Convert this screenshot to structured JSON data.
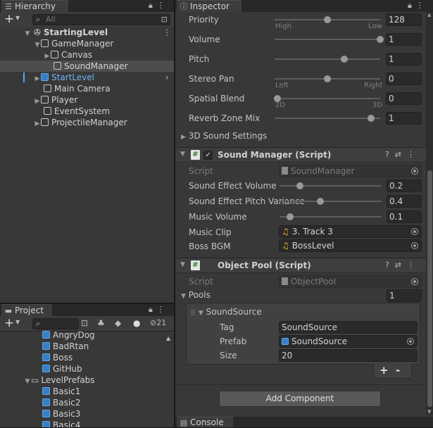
{
  "hierarchy": {
    "tab_label": "Hierarchy",
    "add_label": "+",
    "search_placeholder": "All",
    "scene_name": "StartingLevel",
    "items": [
      {
        "label": "GameManager"
      },
      {
        "label": "Canvas"
      },
      {
        "label": "SoundManager"
      },
      {
        "label": "StartLevel"
      },
      {
        "label": "Main Camera"
      },
      {
        "label": "Player"
      },
      {
        "label": "EventSystem"
      },
      {
        "label": "ProjectileManager"
      }
    ]
  },
  "project": {
    "tab_label": "Project",
    "add_label": "+",
    "hidden_count": "21",
    "items": [
      {
        "label": "AngryDog"
      },
      {
        "label": "BadRtan"
      },
      {
        "label": "Boss"
      },
      {
        "label": "GitHub"
      },
      {
        "label": "LevelPrefabs"
      },
      {
        "label": "Basic1"
      },
      {
        "label": "Basic2"
      },
      {
        "label": "Basic3"
      },
      {
        "label": "Basic4"
      }
    ]
  },
  "inspector": {
    "tab_label": "Inspector",
    "audio_source": {
      "priority": {
        "label": "Priority",
        "value": "128",
        "min_label": "High",
        "max_label": "Low",
        "fraction": 0.5
      },
      "volume": {
        "label": "Volume",
        "value": "1",
        "fraction": 1.0
      },
      "pitch": {
        "label": "Pitch",
        "value": "1",
        "fraction": 0.66
      },
      "stereo_pan": {
        "label": "Stereo Pan",
        "value": "0",
        "min_label": "Left",
        "max_label": "Right",
        "fraction": 0.5
      },
      "spatial_blend": {
        "label": "Spatial Blend",
        "value": "0",
        "min_label": "2D",
        "max_label": "3D",
        "fraction": 0.0
      },
      "reverb": {
        "label": "Reverb Zone Mix",
        "value": "1",
        "fraction": 0.91
      },
      "sound_settings_label": "3D Sound Settings"
    },
    "sound_manager": {
      "title": "Sound Manager (Script)",
      "script_label": "Script",
      "script_value": "SoundManager",
      "sfx_volume": {
        "label": "Sound Effect Volume",
        "value": "0.2",
        "fraction": 0.2
      },
      "sfx_pitch": {
        "label": "Sound Effect Pitch Variance",
        "value": "0.4",
        "fraction": 0.4
      },
      "music_volume": {
        "label": "Music Volume",
        "value": "0.1",
        "fraction": 0.1
      },
      "music_clip": {
        "label": "Music Clip",
        "value": "3. Track 3"
      },
      "boss_bgm": {
        "label": "Boss BGM",
        "value": "BossLevel"
      }
    },
    "object_pool": {
      "title": "Object Pool (Script)",
      "script_label": "Script",
      "script_value": "ObjectPool",
      "pools_label": "Pools",
      "pools_count": "1",
      "element_label": "SoundSource",
      "tag_label": "Tag",
      "tag_value": "SoundSource",
      "prefab_label": "Prefab",
      "prefab_value": "SoundSource",
      "size_label": "Size",
      "size_value": "20",
      "plus_label": "+",
      "minus_label": "-"
    },
    "add_component_label": "Add Component"
  },
  "console": {
    "tab_label": "Console"
  },
  "colors": {
    "selection_blue": "#5fa8ea",
    "music_icon": "#e6b422",
    "script_green": "#2e7d32"
  }
}
